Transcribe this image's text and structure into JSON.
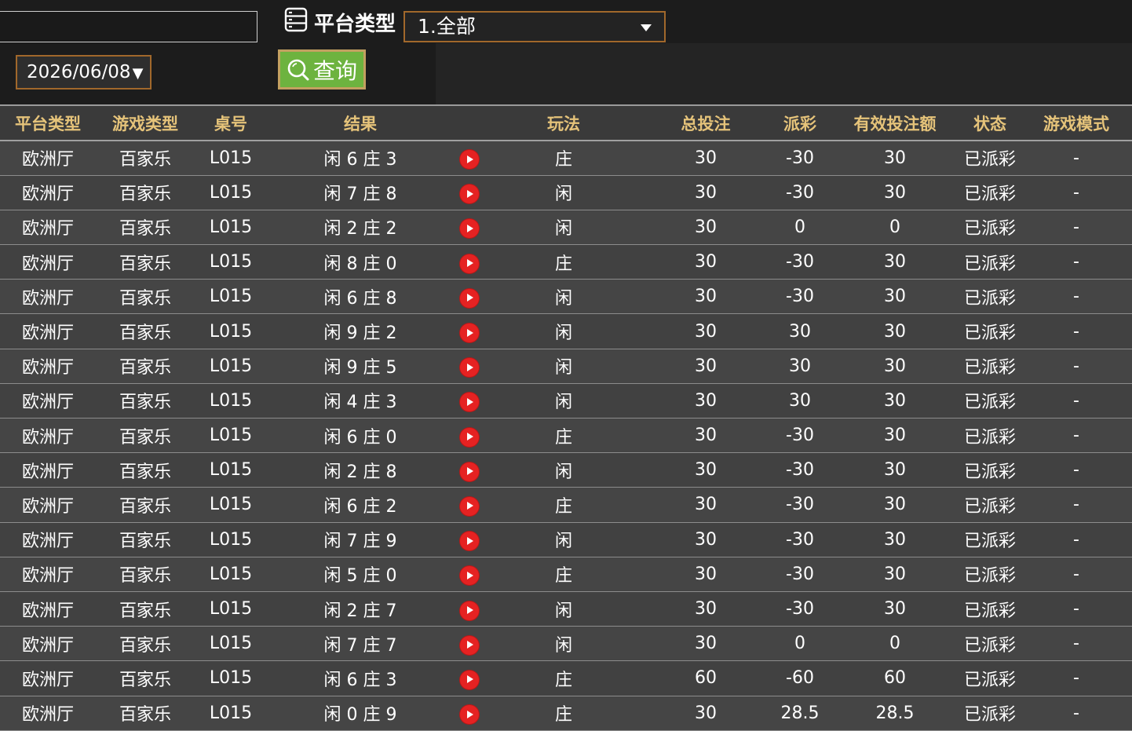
{
  "filters": {
    "text_value": "",
    "date_value": "2026/06/08",
    "platform_label": "平台类型",
    "platform_value": "1.全部",
    "query_label": "查询"
  },
  "table": {
    "headers": {
      "platform": "平台类型",
      "game": "游戏类型",
      "table_no": "桌号",
      "result": "结果",
      "play": "玩法",
      "total_bet": "总投注",
      "payout": "派彩",
      "valid_bet": "有效投注额",
      "status": "状态",
      "mode": "游戏模式"
    },
    "rows": [
      {
        "platform": "欧洲厅",
        "game": "百家乐",
        "table_no": "L015",
        "result": "闲 6 庄 3",
        "play": "庄",
        "total_bet": "30",
        "payout": "-30",
        "valid_bet": "30",
        "status": "已派彩",
        "mode": "-"
      },
      {
        "platform": "欧洲厅",
        "game": "百家乐",
        "table_no": "L015",
        "result": "闲 7 庄 8",
        "play": "闲",
        "total_bet": "30",
        "payout": "-30",
        "valid_bet": "30",
        "status": "已派彩",
        "mode": "-"
      },
      {
        "platform": "欧洲厅",
        "game": "百家乐",
        "table_no": "L015",
        "result": "闲 2 庄 2",
        "play": "闲",
        "total_bet": "30",
        "payout": "0",
        "valid_bet": "0",
        "status": "已派彩",
        "mode": "-"
      },
      {
        "platform": "欧洲厅",
        "game": "百家乐",
        "table_no": "L015",
        "result": "闲 8 庄 0",
        "play": "庄",
        "total_bet": "30",
        "payout": "-30",
        "valid_bet": "30",
        "status": "已派彩",
        "mode": "-"
      },
      {
        "platform": "欧洲厅",
        "game": "百家乐",
        "table_no": "L015",
        "result": "闲 6 庄 8",
        "play": "闲",
        "total_bet": "30",
        "payout": "-30",
        "valid_bet": "30",
        "status": "已派彩",
        "mode": "-"
      },
      {
        "platform": "欧洲厅",
        "game": "百家乐",
        "table_no": "L015",
        "result": "闲 9 庄 2",
        "play": "闲",
        "total_bet": "30",
        "payout": "30",
        "valid_bet": "30",
        "status": "已派彩",
        "mode": "-"
      },
      {
        "platform": "欧洲厅",
        "game": "百家乐",
        "table_no": "L015",
        "result": "闲 9 庄 5",
        "play": "闲",
        "total_bet": "30",
        "payout": "30",
        "valid_bet": "30",
        "status": "已派彩",
        "mode": "-"
      },
      {
        "platform": "欧洲厅",
        "game": "百家乐",
        "table_no": "L015",
        "result": "闲 4 庄 3",
        "play": "闲",
        "total_bet": "30",
        "payout": "30",
        "valid_bet": "30",
        "status": "已派彩",
        "mode": "-"
      },
      {
        "platform": "欧洲厅",
        "game": "百家乐",
        "table_no": "L015",
        "result": "闲 6 庄 0",
        "play": "庄",
        "total_bet": "30",
        "payout": "-30",
        "valid_bet": "30",
        "status": "已派彩",
        "mode": "-"
      },
      {
        "platform": "欧洲厅",
        "game": "百家乐",
        "table_no": "L015",
        "result": "闲 2 庄 8",
        "play": "闲",
        "total_bet": "30",
        "payout": "-30",
        "valid_bet": "30",
        "status": "已派彩",
        "mode": "-"
      },
      {
        "platform": "欧洲厅",
        "game": "百家乐",
        "table_no": "L015",
        "result": "闲 6 庄 2",
        "play": "庄",
        "total_bet": "30",
        "payout": "-30",
        "valid_bet": "30",
        "status": "已派彩",
        "mode": "-"
      },
      {
        "platform": "欧洲厅",
        "game": "百家乐",
        "table_no": "L015",
        "result": "闲 7 庄 9",
        "play": "闲",
        "total_bet": "30",
        "payout": "-30",
        "valid_bet": "30",
        "status": "已派彩",
        "mode": "-"
      },
      {
        "platform": "欧洲厅",
        "game": "百家乐",
        "table_no": "L015",
        "result": "闲 5 庄 0",
        "play": "庄",
        "total_bet": "30",
        "payout": "-30",
        "valid_bet": "30",
        "status": "已派彩",
        "mode": "-"
      },
      {
        "platform": "欧洲厅",
        "game": "百家乐",
        "table_no": "L015",
        "result": "闲 2 庄 7",
        "play": "闲",
        "total_bet": "30",
        "payout": "-30",
        "valid_bet": "30",
        "status": "已派彩",
        "mode": "-"
      },
      {
        "platform": "欧洲厅",
        "game": "百家乐",
        "table_no": "L015",
        "result": "闲 7 庄 7",
        "play": "闲",
        "total_bet": "30",
        "payout": "0",
        "valid_bet": "0",
        "status": "已派彩",
        "mode": "-"
      },
      {
        "platform": "欧洲厅",
        "game": "百家乐",
        "table_no": "L015",
        "result": "闲 6 庄 3",
        "play": "庄",
        "total_bet": "60",
        "payout": "-60",
        "valid_bet": "60",
        "status": "已派彩",
        "mode": "-"
      },
      {
        "platform": "欧洲厅",
        "game": "百家乐",
        "table_no": "L015",
        "result": "闲 0 庄 9",
        "play": "庄",
        "total_bet": "30",
        "payout": "28.5",
        "valid_bet": "28.5",
        "status": "已派彩",
        "mode": "-"
      }
    ]
  },
  "colors": {
    "header_text": "#e5c37a",
    "loss": "#7ee02c",
    "win": "#e5263b",
    "status_settled": "#7ee02c",
    "query_button": "#6db33f",
    "select_border": "#a1682b"
  },
  "icons": {
    "platform": "server-list-icon",
    "query": "magnifier-icon",
    "replay": "play-icon"
  }
}
